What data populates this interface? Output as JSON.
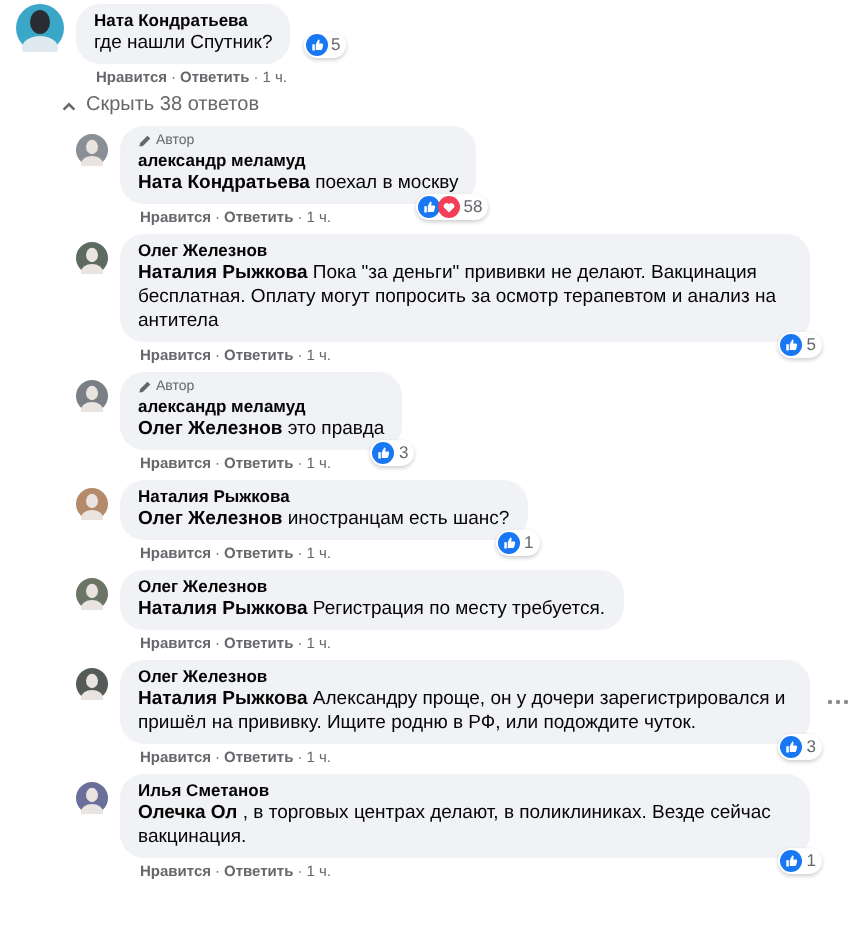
{
  "action_separator": "·",
  "comment": {
    "author": "Ната Кондратьева",
    "text": "где нашли Спутник?",
    "reactions": {
      "like": true,
      "count": "5"
    },
    "actions": {
      "like": "Нравится",
      "reply": "Ответить",
      "time": "1 ч."
    }
  },
  "replies_toggle": {
    "label": "Скрыть 38 ответов",
    "expanded": true
  },
  "replies": [
    {
      "badge": "Автор",
      "author": "александр меламуд",
      "mention": "Ната Кондратьева",
      "text": "поехал в москву",
      "reactions": {
        "like": true,
        "love": true,
        "count": "58"
      },
      "actions": {
        "like": "Нравится",
        "reply": "Ответить",
        "time": "1 ч."
      },
      "show_more": false
    },
    {
      "author": "Олег Железнов",
      "mention": "Наталия Рыжкова",
      "text": "Пока \"за деньги\" прививки не делают. Вакцинация бесплатная. Оплату могут попросить за осмотр терапевтом и анализ на антитела",
      "reactions": {
        "like": true,
        "count": "5"
      },
      "actions": {
        "like": "Нравится",
        "reply": "Ответить",
        "time": "1 ч."
      },
      "show_more": false
    },
    {
      "badge": "Автор",
      "author": "александр меламуд",
      "mention": "Олег Железнов",
      "text": "это правда",
      "reactions": {
        "like": true,
        "count": "3"
      },
      "actions": {
        "like": "Нравится",
        "reply": "Ответить",
        "time": "1 ч."
      },
      "show_more": false
    },
    {
      "author": "Наталия Рыжкова",
      "mention": "Олег Железнов",
      "text": "иностранцам есть шанс?",
      "reactions": {
        "like": true,
        "count": "1"
      },
      "actions": {
        "like": "Нравится",
        "reply": "Ответить",
        "time": "1 ч."
      },
      "show_more": false
    },
    {
      "author": "Олег Железнов",
      "mention": "Наталия Рыжкова",
      "text": "Регистрация по месту требуется.",
      "actions": {
        "like": "Нравится",
        "reply": "Ответить",
        "time": "1 ч."
      },
      "show_more": false
    },
    {
      "author": "Олег Железнов",
      "mention": "Наталия Рыжкова",
      "text": "Александру проще, он у дочери зарегистрировался и пришёл на прививку. Ищите родню в РФ, или подождите чуток.",
      "reactions": {
        "like": true,
        "count": "3"
      },
      "actions": {
        "like": "Нравится",
        "reply": "Ответить",
        "time": "1 ч."
      },
      "show_more": true
    },
    {
      "author": "Илья Сметанов",
      "mention": "Олечка Ол",
      "text": ", в торговых центрах делают, в поликлиниках. Везде сейчас вакцинация.",
      "reactions": {
        "like": true,
        "count": "1"
      },
      "actions": {
        "like": "Нравится",
        "reply": "Ответить",
        "time": "1 ч."
      },
      "show_more": false
    }
  ]
}
